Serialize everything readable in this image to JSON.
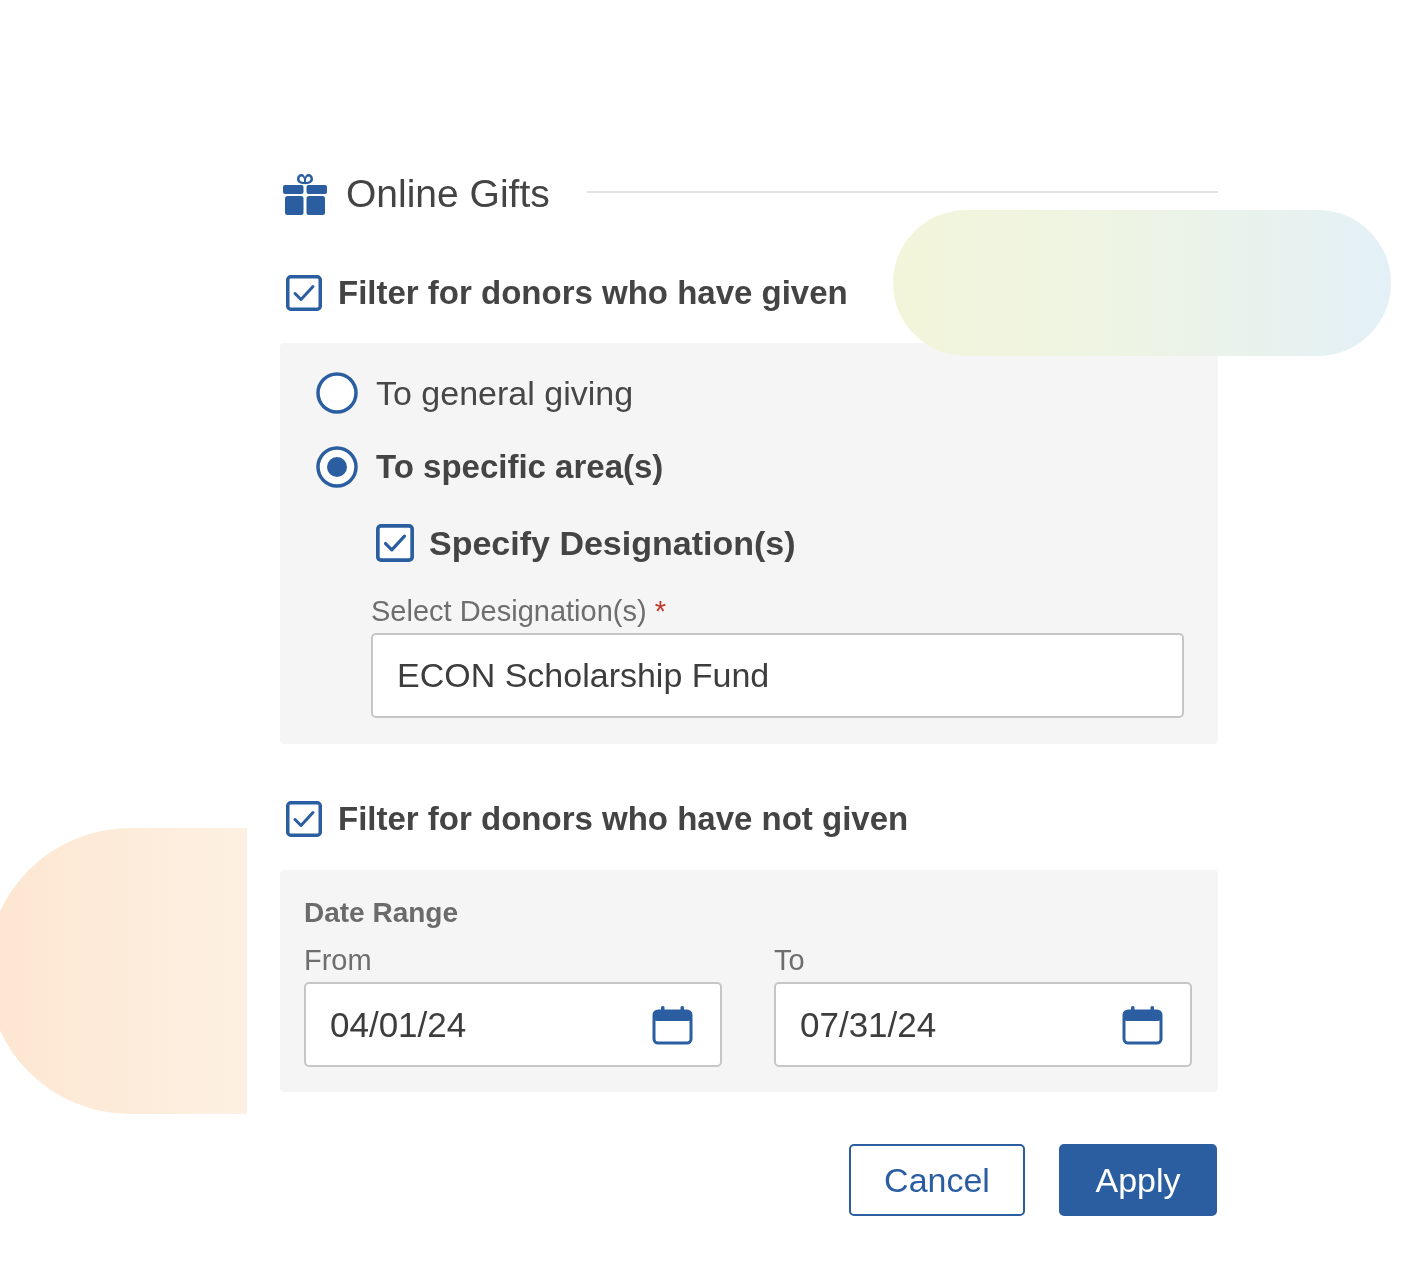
{
  "section": {
    "title": "Online Gifts"
  },
  "given_filter": {
    "label": "Filter for donors who have given",
    "checked": true,
    "options": [
      {
        "label": "To general giving",
        "selected": false
      },
      {
        "label": "To specific area(s)",
        "selected": true
      }
    ],
    "designation": {
      "label": "Specify Designation(s)",
      "checked": true,
      "field_label": "Select Designation(s)",
      "required_mark": "*",
      "value": "ECON Scholarship Fund"
    }
  },
  "not_given_filter": {
    "label": "Filter for donors who have not given",
    "checked": true,
    "date_range": {
      "title": "Date Range",
      "fields": [
        {
          "label": "From",
          "value": "04/01/24"
        },
        {
          "label": "To",
          "value": "07/31/24"
        }
      ]
    }
  },
  "buttons": [
    {
      "label": "Cancel",
      "kind": "secondary"
    },
    {
      "label": "Apply",
      "kind": "primary"
    }
  ]
}
